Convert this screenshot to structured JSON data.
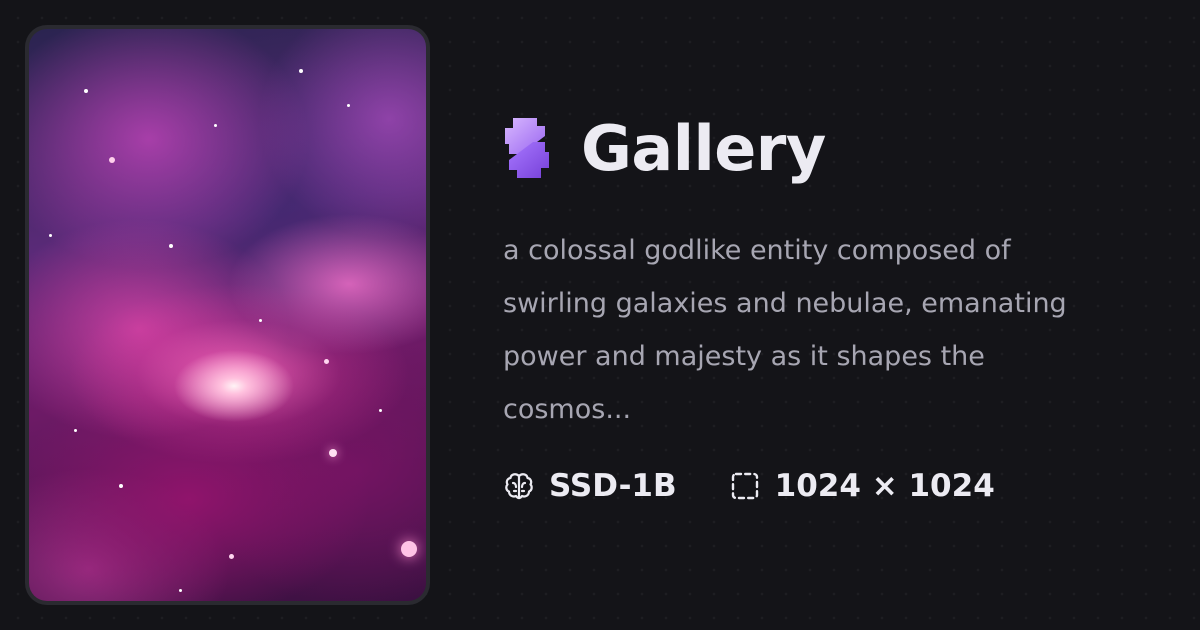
{
  "header": {
    "title": "Gallery",
    "logo_icon": "gallery-logo-icon"
  },
  "image": {
    "icon": "nebula-artwork-image"
  },
  "description": "a colossal godlike entity composed of swirling galaxies and nebulae, emanating power and majesty as it shapes the cosmos...",
  "meta": {
    "model": {
      "icon": "brain-icon",
      "label": "SSD-1B"
    },
    "size": {
      "icon": "dashed-square-icon",
      "label": "1024 × 1024"
    }
  },
  "colors": {
    "background": "#141418",
    "title": "#ecebf2",
    "description": "#a7a6b2",
    "logo_light": "#c9a8ff",
    "logo_dark": "#8a52e6"
  }
}
